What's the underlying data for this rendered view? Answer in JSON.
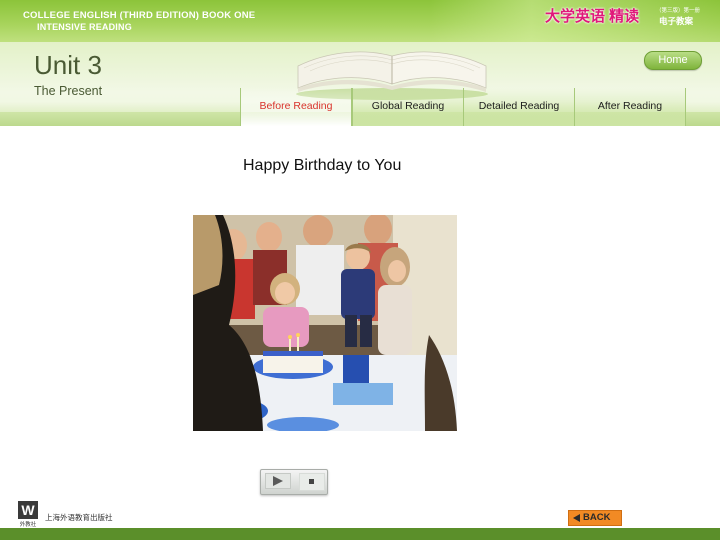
{
  "banner": {
    "series_line1": "COLLEGE ENGLISH (THIRD EDITION) BOOK ONE",
    "series_line2": "INTENSIVE READING",
    "brand_cn": "大学英语 精读",
    "edition_cn": "（第三版）第一册",
    "ebook_cn": "电子教案"
  },
  "header": {
    "unit_title": "Unit 3",
    "unit_subtitle": "The Present",
    "home_label": "Home"
  },
  "tabs": [
    {
      "label": "Before Reading",
      "active": true
    },
    {
      "label": "Global Reading",
      "active": false
    },
    {
      "label": "Detailed Reading",
      "active": false
    },
    {
      "label": "After Reading",
      "active": false
    }
  ],
  "content": {
    "section_heading": "Happy Birthday to You"
  },
  "footer": {
    "publisher_logo_letter": "W",
    "publisher_logo_caption": "外教社",
    "publisher_cn": "上海外语教育出版社",
    "back_label": "BACK"
  },
  "colors": {
    "brand_green": "#8cc43a",
    "active_tab_text": "#d9332c",
    "brand_pink": "#e0187a",
    "back_orange": "#f28a24"
  },
  "icons": {
    "play": "play-icon",
    "stop": "stop-icon",
    "back": "back-arrow-icon"
  }
}
